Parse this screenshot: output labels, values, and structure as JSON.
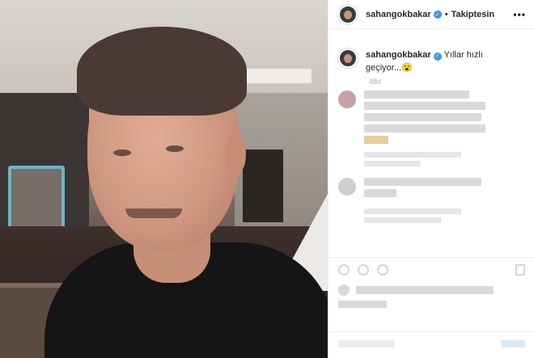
{
  "post": {
    "username": "sahangokbakar",
    "follow_label": "Takiptesin",
    "separator": "•",
    "more_label": "•••",
    "caption_text": "Yıllar hızlı geçiyor...😮",
    "timestamp": "48d"
  },
  "colors": {
    "verified": "#3897f0",
    "text": "#262626",
    "muted": "#b3b3b3"
  },
  "icons": [
    "verified-badge-icon",
    "more-options-icon",
    "heart-icon",
    "comment-icon",
    "share-icon",
    "bookmark-icon"
  ]
}
